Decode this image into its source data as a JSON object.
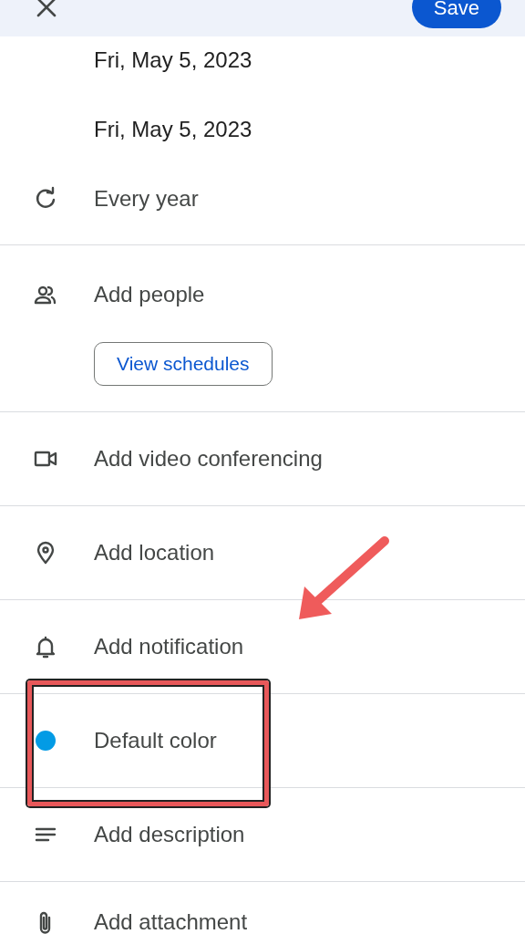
{
  "top_bar": {
    "save_button": "Save"
  },
  "sections": [
    {
      "rows": [
        {
          "kind": "date",
          "label": "Fri, May 5, 2023"
        },
        {
          "kind": "date",
          "label": "Fri, May 5, 2023"
        },
        {
          "kind": "repeat",
          "label": "Every year"
        }
      ]
    },
    {
      "rows": [
        {
          "kind": "people",
          "label": "Add people",
          "button": "View schedules"
        }
      ]
    },
    {
      "rows": [
        {
          "kind": "video",
          "label": "Add video conferencing"
        }
      ]
    },
    {
      "rows": [
        {
          "kind": "location",
          "label": "Add location"
        }
      ]
    },
    {
      "rows": [
        {
          "kind": "notification",
          "label": "Add notification"
        }
      ]
    },
    {
      "rows": [
        {
          "kind": "color",
          "label": "Default color",
          "color": "#039be5",
          "highlighted": true
        }
      ]
    },
    {
      "rows": [
        {
          "kind": "description",
          "label": "Add description"
        }
      ]
    },
    {
      "rows": [
        {
          "kind": "attachment",
          "label": "Add attachment"
        }
      ]
    }
  ]
}
